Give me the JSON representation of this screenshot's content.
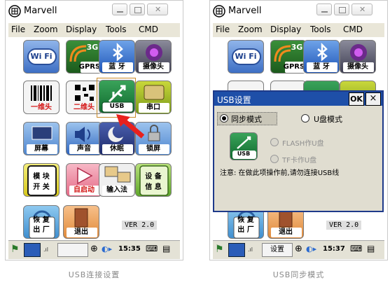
{
  "left_screen": {
    "app_title": "Marvell",
    "menu": [
      "File",
      "Zoom",
      "Display",
      "Tools",
      "CMD"
    ],
    "tiles": [
      {
        "label": "",
        "icon": "wifi-icon"
      },
      {
        "label": "GPRS",
        "icon": "3g-icon",
        "top_text": "3G"
      },
      {
        "label": "蓝 牙",
        "icon": "bluetooth-icon"
      },
      {
        "label": "摄像头",
        "icon": "camera-icon"
      },
      {
        "label": "一维头",
        "icon": "barcode-icon"
      },
      {
        "label": "二维头",
        "icon": "qrcode-icon"
      },
      {
        "label": "USB",
        "icon": "usb-icon"
      },
      {
        "label": "串口",
        "icon": "serial-port-icon"
      },
      {
        "label": "屏幕",
        "icon": "screen-icon"
      },
      {
        "label": "声音",
        "icon": "speaker-icon"
      },
      {
        "label": "休眠",
        "icon": "sleep-icon"
      },
      {
        "label": "锁屏",
        "icon": "lock-icon"
      },
      {
        "label": "模 块\n开 关",
        "icon": "module-switch-icon"
      },
      {
        "label": "自启动",
        "icon": "autostart-icon"
      },
      {
        "label": "输入法",
        "icon": "input-method-icon"
      },
      {
        "label": "设 备\n信 息",
        "icon": "device-info-icon"
      },
      {
        "label": "恢 复\n出 厂",
        "icon": "factory-reset-icon"
      },
      {
        "label": "退出",
        "icon": "exit-icon"
      }
    ],
    "wifi_text": "Wi Fi",
    "version": "VER 2.0",
    "taskbar_time": "15:35"
  },
  "right_screen": {
    "app_title": "Marvell",
    "menu": [
      "File",
      "Zoom",
      "Display",
      "Tools",
      "CMD"
    ],
    "dialog": {
      "title": "USB设置",
      "ok_label": "OK",
      "close_label": "×",
      "option_sync": "同步模式",
      "option_udisk": "U盘模式",
      "option_flash": "FLASH作U盘",
      "option_tf": "TF卡作U盘",
      "note": "注意: 在做此项操作前,请勿连接USB线",
      "usb_label": "USB"
    },
    "tiles_bottom": [
      {
        "label": "恢 复\n出 厂"
      },
      {
        "label": "退出"
      }
    ],
    "version": "VER 2.0",
    "taskbar_task": "设置",
    "taskbar_time": "15:37"
  },
  "captions": {
    "left": "USB连接设置",
    "right": "USB同步模式"
  },
  "colors": {
    "menubar": "#e9e6d8",
    "dialog_title": "#1e4fa8",
    "highlight_box": "#c98a2a",
    "arrow": "#e8211e"
  }
}
